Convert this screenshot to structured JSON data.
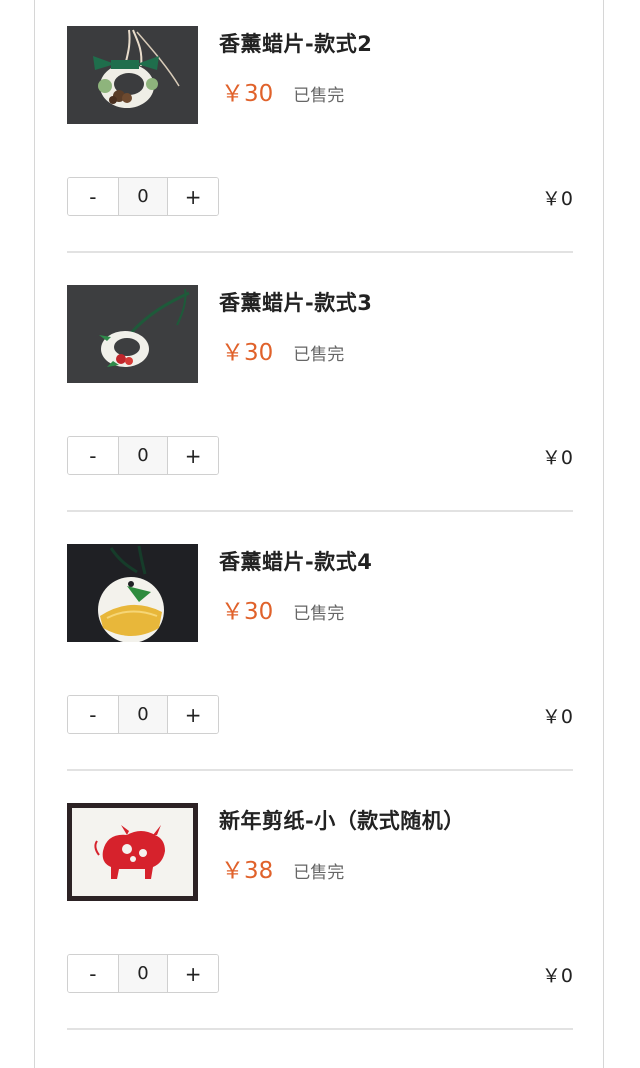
{
  "colors": {
    "price": "#e0622b",
    "text": "#222222",
    "muted": "#666666",
    "divider": "#e2e2e2"
  },
  "items": [
    {
      "title": "香薰蜡片-款式2",
      "price": "￥30",
      "status": "已售完",
      "minus": "-",
      "qty": "0",
      "plus": "+",
      "subtotal": "￥0",
      "image": "wax-tablet-ring-photo"
    },
    {
      "title": "香薰蜡片-款式3",
      "price": "￥30",
      "status": "已售完",
      "minus": "-",
      "qty": "0",
      "plus": "+",
      "subtotal": "￥0",
      "image": "wax-tablet-ring-red-flower-photo"
    },
    {
      "title": "香薰蜡片-款式4",
      "price": "￥30",
      "status": "已售完",
      "minus": "-",
      "qty": "0",
      "plus": "+",
      "subtotal": "￥0",
      "image": "wax-tablet-round-citrus-photo"
    },
    {
      "title": "新年剪纸-小（款式随机）",
      "price": "￥38",
      "status": "已售完",
      "minus": "-",
      "qty": "0",
      "plus": "+",
      "subtotal": "￥0",
      "image": "framed-paper-cut-ox-photo"
    }
  ]
}
